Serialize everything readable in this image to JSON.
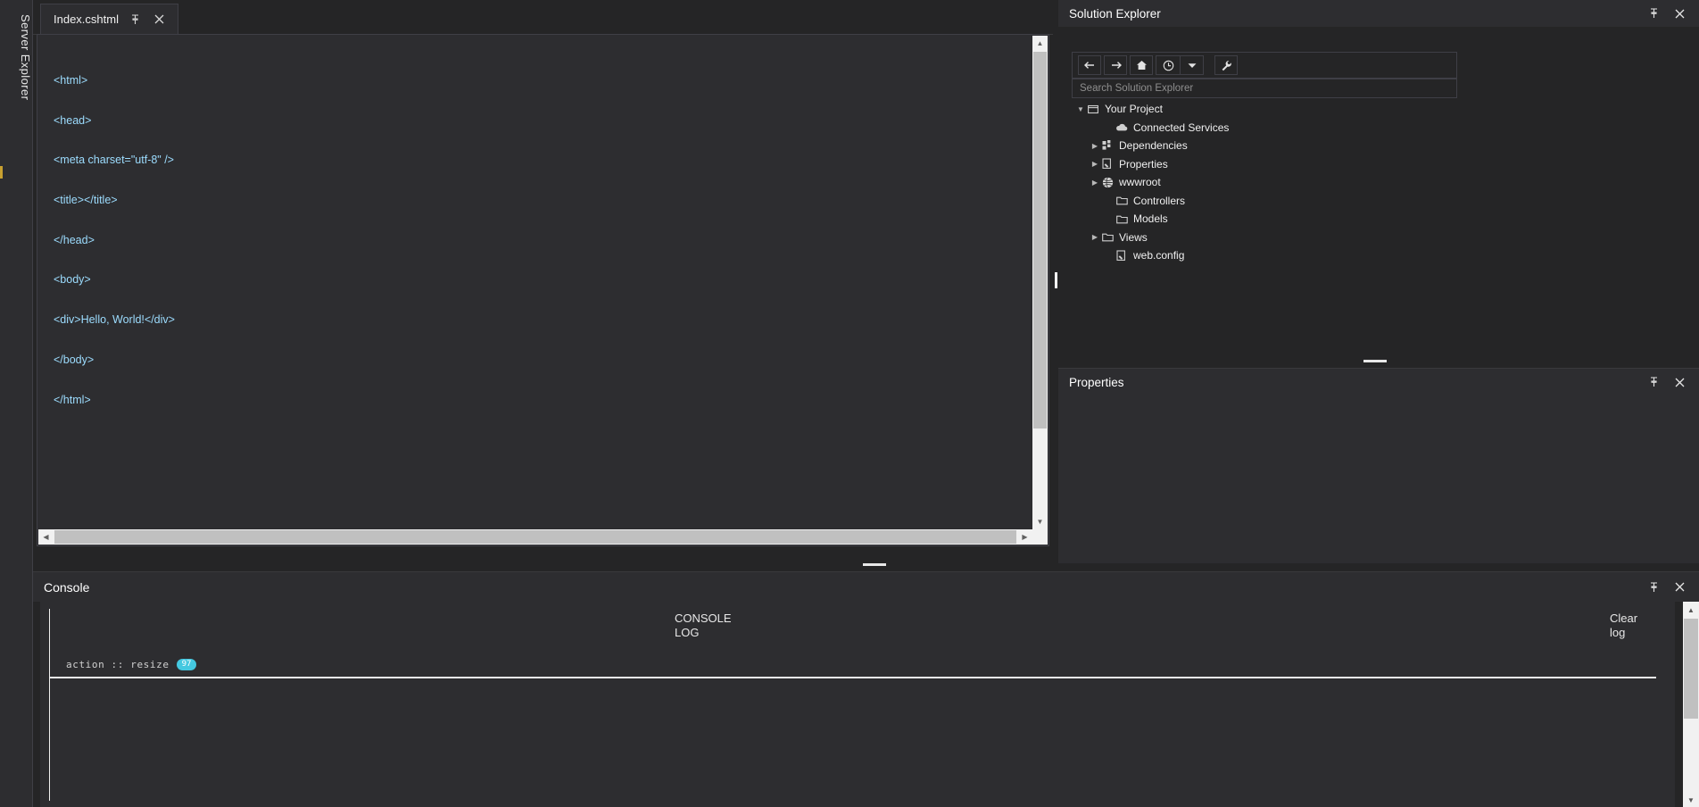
{
  "left_strip": {
    "label": "Server Explorer"
  },
  "editor": {
    "tab": {
      "title": "Index.cshtml",
      "pin_icon": "pin-icon",
      "close_icon": "close-icon"
    },
    "code_lines": [
      "<html>",
      "<head>",
      "<meta charset=\"utf-8\" />",
      "<title></title>",
      "</head>",
      "<body>",
      "<div>Hello, World!</div>",
      "</body>",
      "</html>"
    ]
  },
  "solution_explorer": {
    "title": "Solution Explorer",
    "pin_icon": "pin-icon",
    "close_icon": "close-icon",
    "toolbar": [
      {
        "name": "back-button",
        "icon": "arrow-left-icon"
      },
      {
        "name": "forward-button",
        "icon": "arrow-right-icon"
      },
      {
        "name": "home-button",
        "icon": "home-icon"
      },
      {
        "name": "pending-changes-button",
        "icon": "clock-icon"
      },
      {
        "name": "pending-changes-dropdown",
        "icon": "chevron-down-icon"
      },
      {
        "name": "properties-button",
        "icon": "wrench-icon"
      }
    ],
    "search": {
      "placeholder": "Search Solution Explorer",
      "value": ""
    },
    "tree": [
      {
        "label": "Your Project",
        "icon": "solution-icon",
        "indent": 0,
        "twisty": "expanded"
      },
      {
        "label": "Connected Services",
        "icon": "cloud-icon",
        "indent": 2,
        "twisty": "none"
      },
      {
        "label": "Dependencies",
        "icon": "dependencies-icon",
        "indent": 1,
        "twisty": "collapsed"
      },
      {
        "label": "Properties",
        "icon": "properties-file-icon",
        "indent": 1,
        "twisty": "collapsed"
      },
      {
        "label": "wwwroot",
        "icon": "globe-icon",
        "indent": 1,
        "twisty": "collapsed"
      },
      {
        "label": "Controllers",
        "icon": "folder-icon",
        "indent": 2,
        "twisty": "none"
      },
      {
        "label": "Models",
        "icon": "folder-icon",
        "indent": 2,
        "twisty": "none"
      },
      {
        "label": "Views",
        "icon": "folder-icon",
        "indent": 1,
        "twisty": "collapsed"
      },
      {
        "label": "web.config",
        "icon": "config-file-icon",
        "indent": 2,
        "twisty": "none"
      }
    ]
  },
  "properties": {
    "title": "Properties",
    "pin_icon": "pin-icon",
    "close_icon": "close-icon"
  },
  "console": {
    "title": "Console",
    "pin_icon": "pin-icon",
    "close_icon": "close-icon",
    "log_heading": "CONSOLE LOG",
    "clear_label": "Clear log",
    "entries": [
      {
        "text": "action :: resize",
        "badge": "97"
      }
    ]
  },
  "colors": {
    "accent_badge": "#44c8e0",
    "code_text": "#9cdcfe",
    "panel_bg": "#252526",
    "surface_bg": "#2d2d30",
    "border": "#3f3f46",
    "left_accent": "#c8a030"
  }
}
